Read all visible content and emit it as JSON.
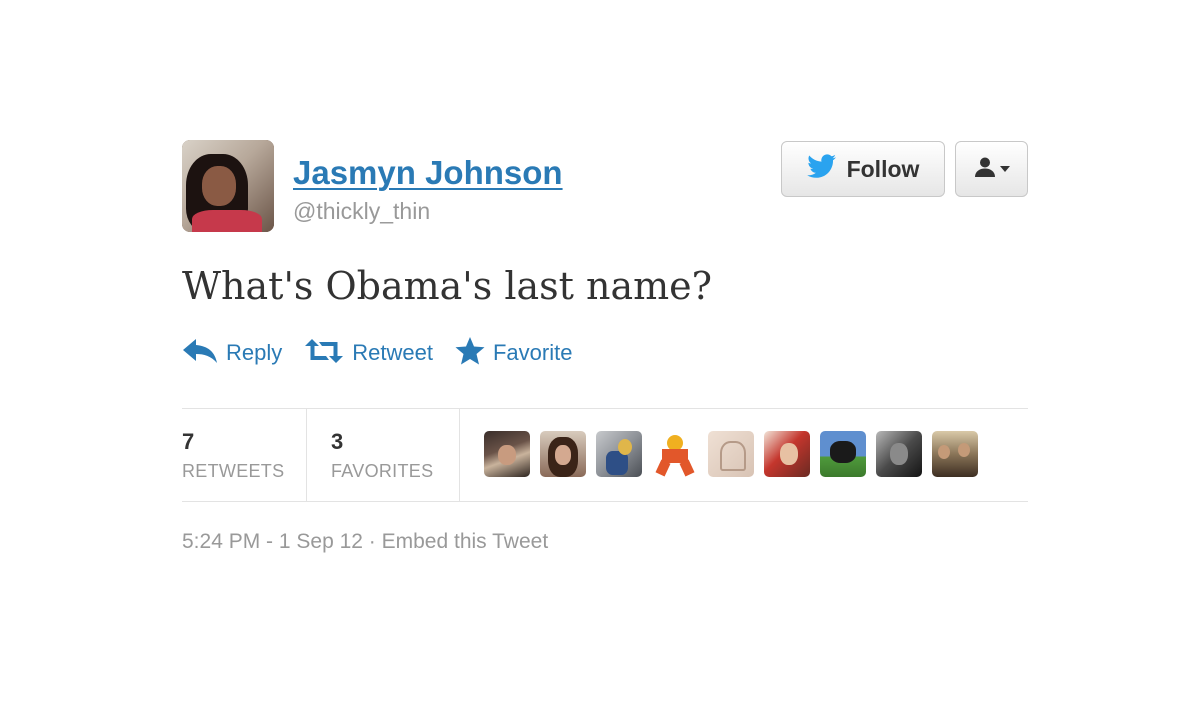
{
  "user": {
    "name": "Jasmyn Johnson",
    "handle": "@thickly_thin"
  },
  "buttons": {
    "follow_label": "Follow"
  },
  "tweet": {
    "text": "What's Obama's last name?"
  },
  "actions": {
    "reply": "Reply",
    "retweet": "Retweet",
    "favorite": "Favorite"
  },
  "stats": {
    "retweets_count": "7",
    "retweets_label": "RETWEETS",
    "favorites_count": "3",
    "favorites_label": "FAVORITES"
  },
  "footer": {
    "timestamp": "5:24 PM - 1 Sep 12",
    "separator": " · ",
    "embed": "Embed this Tweet"
  },
  "colors": {
    "link": "#2a7ab5",
    "muted": "#999999",
    "text": "#333333",
    "twitter_blue": "#2aa3ef"
  },
  "icons": {
    "follow": "twitter-bird-icon",
    "user_menu": "user-icon",
    "reply": "reply-arrow-icon",
    "retweet": "retweet-icon",
    "favorite": "star-icon"
  }
}
